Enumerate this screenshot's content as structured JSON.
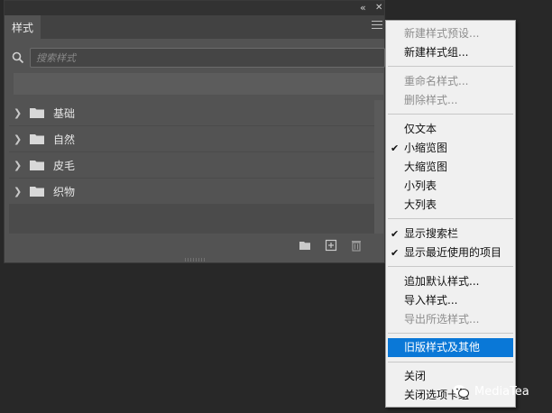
{
  "panel": {
    "collapse_glyph": "«",
    "close_glyph": "✕",
    "tab_label": "样式",
    "search": {
      "placeholder": "搜索样式",
      "value": ""
    },
    "groups": [
      {
        "label": "基础",
        "icon": "folder-icon"
      },
      {
        "label": "自然",
        "icon": "folder-icon"
      },
      {
        "label": "皮毛",
        "icon": "folder-icon"
      },
      {
        "label": "织物",
        "icon": "folder-icon"
      }
    ],
    "footer_icons": [
      "new-group-folder-icon",
      "new-style-icon",
      "delete-trash-icon"
    ]
  },
  "context_menu": {
    "items": [
      {
        "label": "新建样式预设...",
        "disabled": true,
        "checked": false
      },
      {
        "label": "新建样式组...",
        "disabled": false,
        "checked": false
      },
      {
        "label": "重命名样式...",
        "disabled": true,
        "checked": false
      },
      {
        "label": "删除样式...",
        "disabled": true,
        "checked": false
      },
      {
        "label": "仅文本",
        "disabled": false,
        "checked": false
      },
      {
        "label": "小缩览图",
        "disabled": false,
        "checked": true
      },
      {
        "label": "大缩览图",
        "disabled": false,
        "checked": false
      },
      {
        "label": "小列表",
        "disabled": false,
        "checked": false
      },
      {
        "label": "大列表",
        "disabled": false,
        "checked": false
      },
      {
        "label": "显示搜索栏",
        "disabled": false,
        "checked": true
      },
      {
        "label": "显示最近使用的项目",
        "disabled": false,
        "checked": true
      },
      {
        "label": "追加默认样式...",
        "disabled": false,
        "checked": false
      },
      {
        "label": "导入样式...",
        "disabled": false,
        "checked": false
      },
      {
        "label": "导出所选样式...",
        "disabled": true,
        "checked": false
      },
      {
        "label": "旧版样式及其他",
        "disabled": false,
        "checked": false,
        "highlighted": true
      },
      {
        "label": "关闭",
        "disabled": false,
        "checked": false
      },
      {
        "label": "关闭选项卡组",
        "disabled": false,
        "checked": false
      }
    ],
    "check_glyph": "✔",
    "highlight_color": "#0a78d7"
  },
  "watermark": {
    "text": "MediaTea",
    "icon": "wechat-icon"
  }
}
